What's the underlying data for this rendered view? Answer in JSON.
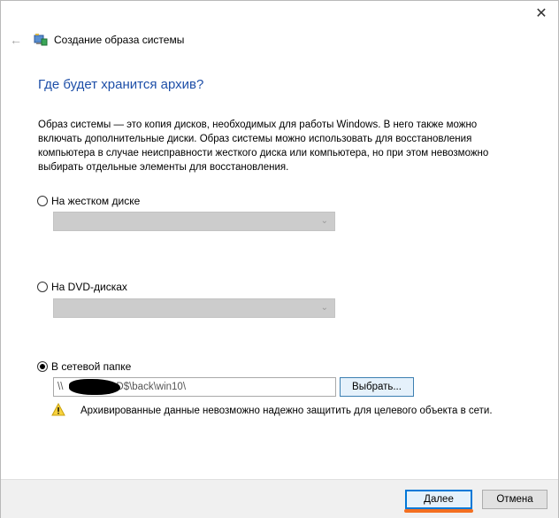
{
  "window": {
    "title": "Создание образа системы",
    "close_glyph": "✕",
    "back_glyph": "←"
  },
  "main": {
    "heading": "Где будет хранится архив?",
    "description": "Образ системы — это копия дисков, необходимых для работы Windows. В него также можно включать дополнительные диски. Образ системы можно использовать для восстановления компьютера в случае неисправности жесткого диска или компьютера, но при этом невозможно выбирать отдельные элементы для восстановления."
  },
  "options": {
    "hard_disk": {
      "label": "На жестком диске",
      "selected": false,
      "combo_value": ""
    },
    "dvd": {
      "label": "На DVD-дисках",
      "selected": false,
      "combo_value": ""
    },
    "network": {
      "label": "В сетевой папке",
      "selected": true,
      "path_prefix": "\\\\",
      "path_value": "D$\\back\\win10\\",
      "browse_label": "Выбрать..."
    }
  },
  "warning": {
    "icon": "warning-icon",
    "text": "Архивированные данные невозможно надежно защитить для целевого объекта в сети."
  },
  "footer": {
    "next_label": "Далее",
    "cancel_label": "Отмена"
  },
  "colors": {
    "heading": "#1e4fa8",
    "accent": "#0078d7",
    "highlight_underline": "#f36f21"
  }
}
